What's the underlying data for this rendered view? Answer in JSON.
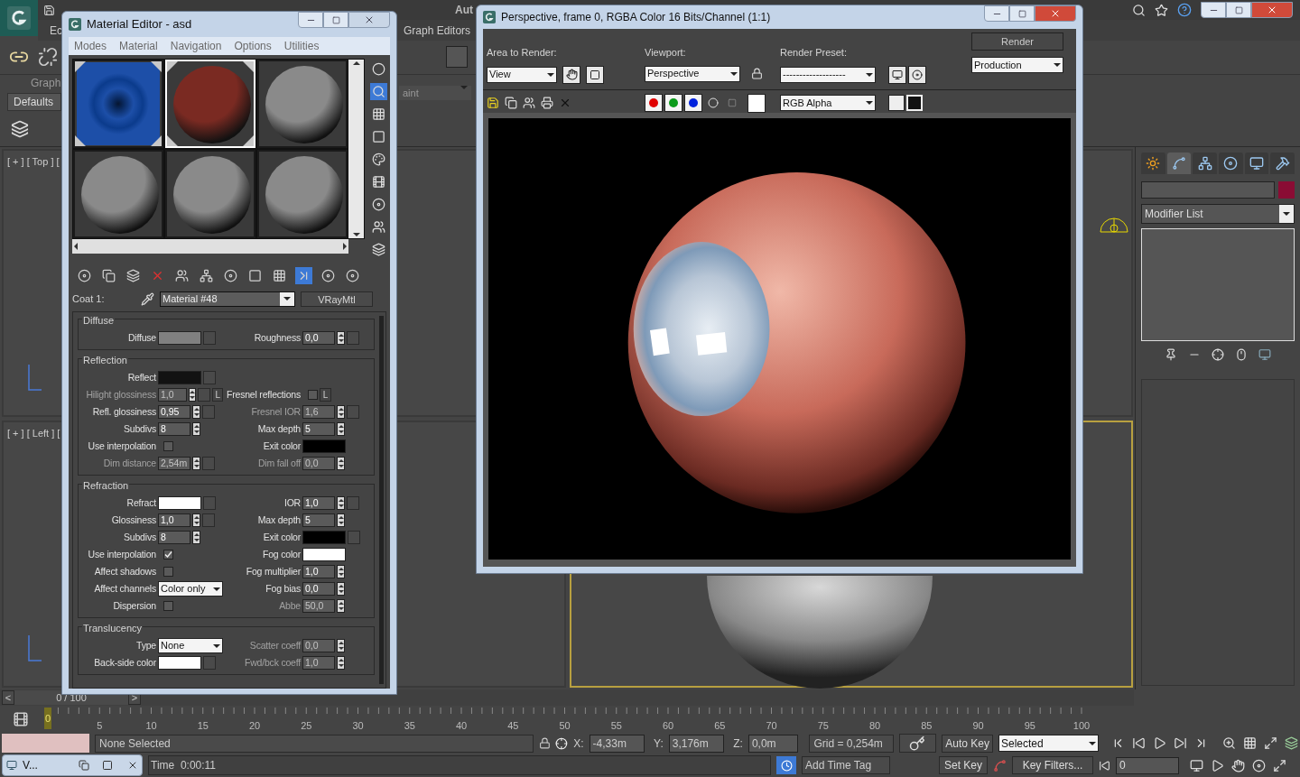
{
  "app": {
    "title_partial": "Aut",
    "menu": [
      "Ec",
      "Graph Editors"
    ],
    "ribbon_tab": "Graph",
    "ribbon_button": "Defaults",
    "field_partial": "aint"
  },
  "viewports": [
    {
      "label": "[ + ] [ Top ] [",
      "active": false
    },
    {
      "label": "[ + ] [ Left ] [",
      "active": false
    },
    {
      "active": true
    }
  ],
  "command_panel": {
    "tabs": [
      {
        "kind": "create",
        "selected": false
      },
      {
        "kind": "modify",
        "selected": true
      },
      {
        "kind": "hierarchy",
        "selected": false
      },
      {
        "kind": "motion",
        "selected": false
      },
      {
        "kind": "display",
        "selected": false
      },
      {
        "kind": "utilities",
        "selected": false
      }
    ],
    "object_swatch": {
      "color": "#8a0c34"
    },
    "modifier_list": "Modifier List"
  },
  "timeline": {
    "position": "0 / 100",
    "prev": "<",
    "next": ">",
    "thumb": "0",
    "level": 0,
    "ticks": [
      "5",
      "10",
      "15",
      "20",
      "25",
      "30",
      "35",
      "40",
      "45",
      "50",
      "55",
      "60",
      "65",
      "70",
      "75",
      "80",
      "85",
      "90",
      "95",
      "100"
    ]
  },
  "status": {
    "selection": "None Selected",
    "x_label": "X:",
    "x": "-4,33m",
    "y_label": "Y:",
    "y": "3,176m",
    "z_label": "Z:",
    "z": "0,0m",
    "grid": "Grid = 0,254m",
    "auto_key": "Auto Key",
    "key_mode": "Selected",
    "set_key": "Set Key",
    "key_filters": "Key Filters...",
    "frame": "0",
    "time": "Time  0:00:11",
    "add_time_tag": "Add Time Tag"
  },
  "minimized_window": {
    "title": "V..."
  },
  "material_editor": {
    "title": "Material Editor - asd",
    "menu": [
      "Modes",
      "Material",
      "Navigation",
      "Options",
      "Utilities"
    ],
    "slots": [
      {
        "kind": "texture",
        "selected": false,
        "hot": true,
        "color": "#1d4fa8"
      },
      {
        "kind": "sphere",
        "selected": true,
        "hot": true,
        "color": "#7a2a22"
      },
      {
        "kind": "sphere",
        "selected": false,
        "hot": false,
        "color": "#8a8a8a"
      },
      {
        "kind": "sphere",
        "selected": false,
        "hot": false,
        "color": "#8a8a8a"
      },
      {
        "kind": "sphere",
        "selected": false,
        "hot": false,
        "color": "#8a8a8a"
      },
      {
        "kind": "sphere",
        "selected": false,
        "hot": false,
        "color": "#8a8a8a"
      }
    ],
    "coat_label": "Coat 1:",
    "material_name": "Material #48",
    "material_type": "VRayMtl",
    "groups": [
      {
        "title": "Diffuse",
        "rows": [
          {
            "left": {
              "kind": "color",
              "label": "Diffuse",
              "color": "#808080",
              "map": true,
              "disabled": false
            },
            "right": {
              "kind": "spinner",
              "label": "Roughness",
              "value": "0,0",
              "map": true,
              "disabled": false
            }
          }
        ]
      },
      {
        "title": "Reflection",
        "rows": [
          {
            "left": {
              "kind": "color",
              "label": "Reflect",
              "color": "#121212",
              "map": true,
              "disabled": false
            },
            "right": null
          },
          {
            "left": {
              "kind": "spinner",
              "label": "Hilight glossiness",
              "value": "1,0",
              "map": true,
              "lock": "L",
              "disabled": true
            },
            "right": {
              "kind": "check",
              "label": "Fresnel reflections",
              "checked": false,
              "lock": "L",
              "disabled": false
            }
          },
          {
            "left": {
              "kind": "spinner",
              "label": "Refl. glossiness",
              "value": "0,95",
              "map": true,
              "disabled": false
            },
            "right": {
              "kind": "spinner",
              "label": "Fresnel IOR",
              "value": "1,6",
              "map": true,
              "disabled": true
            }
          },
          {
            "left": {
              "kind": "spinner",
              "label": "Subdivs",
              "value": "8",
              "map": false,
              "disabled": false
            },
            "right": {
              "kind": "spinner",
              "label": "Max depth",
              "value": "5",
              "map": false,
              "disabled": false
            }
          },
          {
            "left": {
              "kind": "check",
              "label": "Use interpolation",
              "checked": false,
              "disabled": false
            },
            "right": {
              "kind": "color",
              "label": "Exit color",
              "color": "#000000",
              "map": false,
              "disabled": false
            }
          },
          {
            "left": {
              "kind": "spinner",
              "label": "Dim distance",
              "value": "2,54m",
              "map": true,
              "disabled": true
            },
            "right": {
              "kind": "spinner",
              "label": "Dim fall off",
              "value": "0,0",
              "map": false,
              "disabled": true
            }
          }
        ]
      },
      {
        "title": "Refraction",
        "rows": [
          {
            "left": {
              "kind": "color",
              "label": "Refract",
              "color": "#ffffff",
              "map": true,
              "disabled": false
            },
            "right": {
              "kind": "spinner",
              "label": "IOR",
              "value": "1,0",
              "map": true,
              "disabled": false
            }
          },
          {
            "left": {
              "kind": "spinner",
              "label": "Glossiness",
              "value": "1,0",
              "map": true,
              "disabled": false
            },
            "right": {
              "kind": "spinner",
              "label": "Max depth",
              "value": "5",
              "map": false,
              "disabled": false
            }
          },
          {
            "left": {
              "kind": "spinner",
              "label": "Subdivs",
              "value": "8",
              "map": false,
              "disabled": false
            },
            "right": {
              "kind": "color",
              "label": "Exit color",
              "color": "#000000",
              "map": true,
              "disabled": false
            }
          },
          {
            "left": {
              "kind": "check",
              "label": "Use interpolation",
              "checked": true,
              "disabled": false
            },
            "right": {
              "kind": "color",
              "label": "Fog color",
              "color": "#ffffff",
              "map": false,
              "disabled": false
            }
          },
          {
            "left": {
              "kind": "check",
              "label": "Affect shadows",
              "checked": false,
              "disabled": false
            },
            "right": {
              "kind": "spinner",
              "label": "Fog multiplier",
              "value": "1,0",
              "map": false,
              "disabled": false
            }
          },
          {
            "left": {
              "kind": "dropdown",
              "label": "Affect channels",
              "value": "Color only",
              "disabled": false
            },
            "right": {
              "kind": "spinner",
              "label": "Fog bias",
              "value": "0,0",
              "map": false,
              "disabled": false
            }
          },
          {
            "left": {
              "kind": "check",
              "label": "Dispersion",
              "checked": false,
              "disabled": false
            },
            "right": {
              "kind": "spinner",
              "label": "Abbe",
              "value": "50,0",
              "map": false,
              "disabled": true
            }
          }
        ]
      },
      {
        "title": "Translucency",
        "rows": [
          {
            "left": {
              "kind": "dropdown",
              "label": "Type",
              "value": "None",
              "disabled": false
            },
            "right": {
              "kind": "spinner",
              "label": "Scatter coeff",
              "value": "0,0",
              "map": false,
              "disabled": true
            }
          },
          {
            "left": {
              "kind": "color",
              "label": "Back-side color",
              "color": "#ffffff",
              "map": true,
              "disabled": false
            },
            "right": {
              "kind": "spinner",
              "label": "Fwd/bck coeff",
              "value": "1,0",
              "map": false,
              "disabled": true
            }
          }
        ]
      }
    ]
  },
  "render_window": {
    "title": "Perspective, frame 0, RGBA Color 16 Bits/Channel (1:1)",
    "area_label": "Area to Render:",
    "area": "View",
    "viewport_label": "Viewport:",
    "viewport": "Perspective",
    "preset_label": "Render Preset:",
    "preset": "-------------------",
    "render": "Render",
    "mode": "Production",
    "channels": [
      {
        "color": "#e00000"
      },
      {
        "color": "#0a9a1a"
      },
      {
        "color": "#0022dd"
      }
    ],
    "swatch": {
      "color": "#ffffff"
    },
    "display": "RGB Alpha"
  }
}
